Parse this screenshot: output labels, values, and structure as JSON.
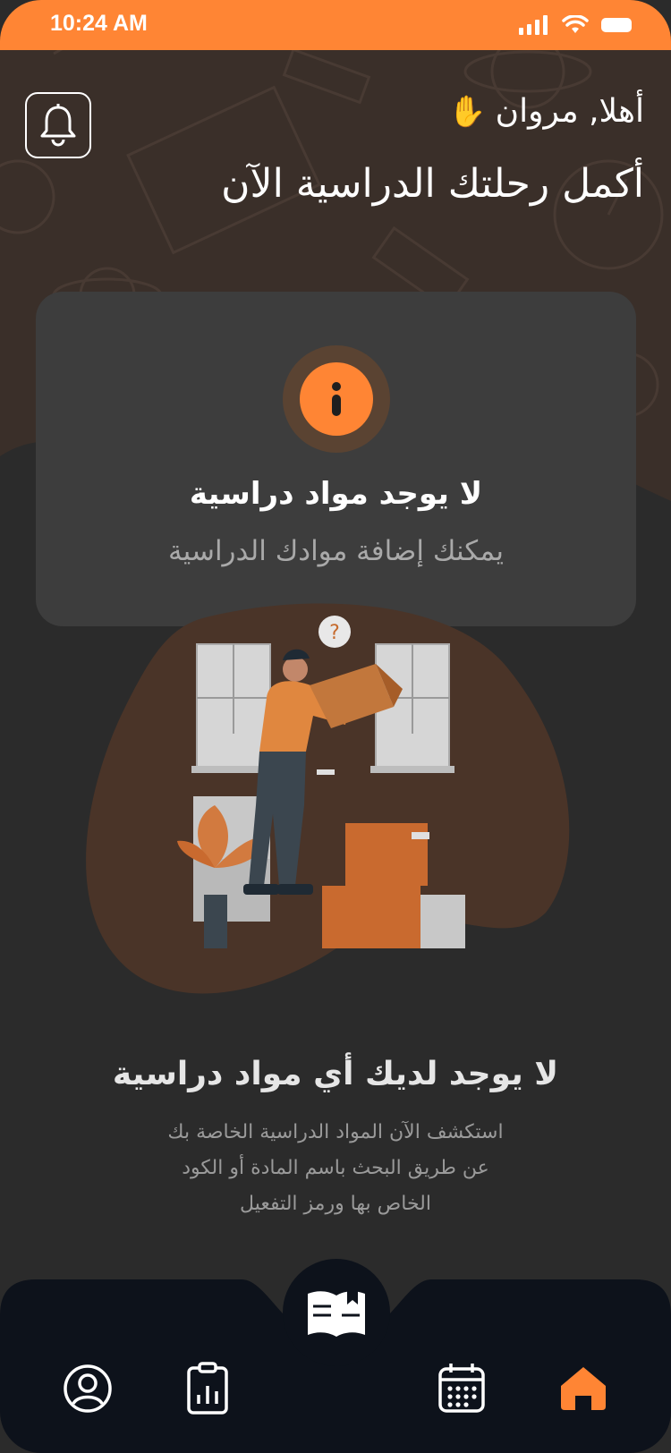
{
  "status_bar": {
    "time": "10:24 AM",
    "icons": [
      "signal-icon",
      "wifi-icon",
      "battery-icon"
    ]
  },
  "header": {
    "greeting": "أهلا, مروان",
    "greeting_emoji_icon": "waving-hand-icon",
    "headline": "أكمل رحلتك الدراسية الآن",
    "notification_icon": "bell-icon"
  },
  "empty_card": {
    "icon": "info-icon",
    "title": "لا يوجد مواد دراسية",
    "subtitle": "يمكنك إضافة موادك الدراسية"
  },
  "empty_state": {
    "title": "لا يوجد لديك أي مواد دراسية",
    "description_lines": [
      "استكشف الآن المواد الدراسية الخاصة بك",
      "عن طريق البحث باسم المادة أو الكود",
      "الخاص بها ورمز التفعيل"
    ]
  },
  "bottom_nav": {
    "items": [
      {
        "icon": "profile-icon",
        "active": false
      },
      {
        "icon": "report-icon",
        "active": false
      },
      {
        "icon": "book-icon",
        "active": false
      },
      {
        "icon": "calendar-icon",
        "active": false
      },
      {
        "icon": "home-icon",
        "active": true
      }
    ]
  },
  "colors": {
    "accent": "#ff8534",
    "background": "#2b2b2b",
    "hero": "#3a2f29",
    "card": "#3d3d3d",
    "nav": "#0d121b"
  }
}
